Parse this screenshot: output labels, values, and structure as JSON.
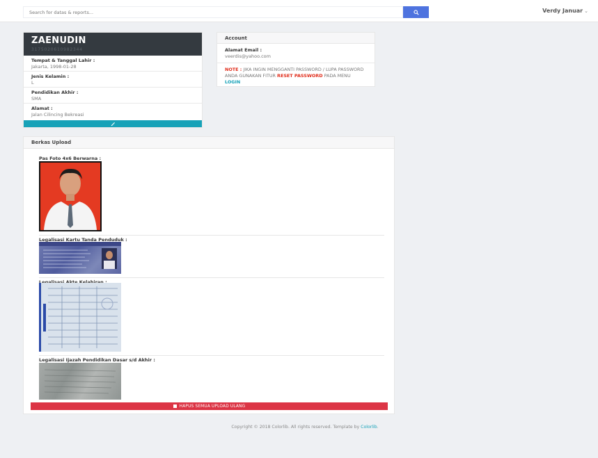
{
  "search": {
    "placeholder": "Search for datas & reports..."
  },
  "user": {
    "name": "Verdy Januar",
    "caret": "⌄"
  },
  "profile": {
    "name": "ZAENUDIN",
    "id_number": "3175020610982344",
    "fields": [
      {
        "label": "Tempat & Tanggal Lahir :",
        "value": "Jakarta, 1998-01-28"
      },
      {
        "label": "Jenis Kelamin :",
        "value": "L"
      },
      {
        "label": "Pendidikan Akhir :",
        "value": "SMA"
      },
      {
        "label": "Alamat :",
        "value": "Jalan Cilincing Bekreasi"
      }
    ]
  },
  "account": {
    "title": "Account",
    "email_label": "Alamat Email :",
    "email_value": "veerdis@yahoo.com",
    "note_prefix": "NOTE :",
    "note_text": " JIKA INGIN MENGGANTI PASSWORD / LUPA PASSWORD ANDA GUNAKAN FITUR ",
    "note_reset": "RESET PASSWORD",
    "note_middle": " PADA MENU ",
    "note_login": "LOGIN"
  },
  "berkas": {
    "title": "Berkas Upload",
    "docs": [
      {
        "label": "Pas Foto 4x6 Berwarna :"
      },
      {
        "label": "Legalisasi Kartu Tanda Penduduk :"
      },
      {
        "label": "Legalisasi Akte Kelahiran :"
      },
      {
        "label": "Legalisasi Ijazah Pendidikan Dasar s/d Akhir :"
      }
    ],
    "delete_label": "HAPUS SEMUA UPLOAD ULANG"
  },
  "footer": {
    "text": "Copyright © 2018 Colorlib. All rights reserved. Template by ",
    "link": "Colorlib",
    "suffix": "."
  },
  "colors": {
    "primary": "#4e73df",
    "info": "#17a2b8",
    "danger": "#dc3545",
    "dark": "#343a40"
  }
}
